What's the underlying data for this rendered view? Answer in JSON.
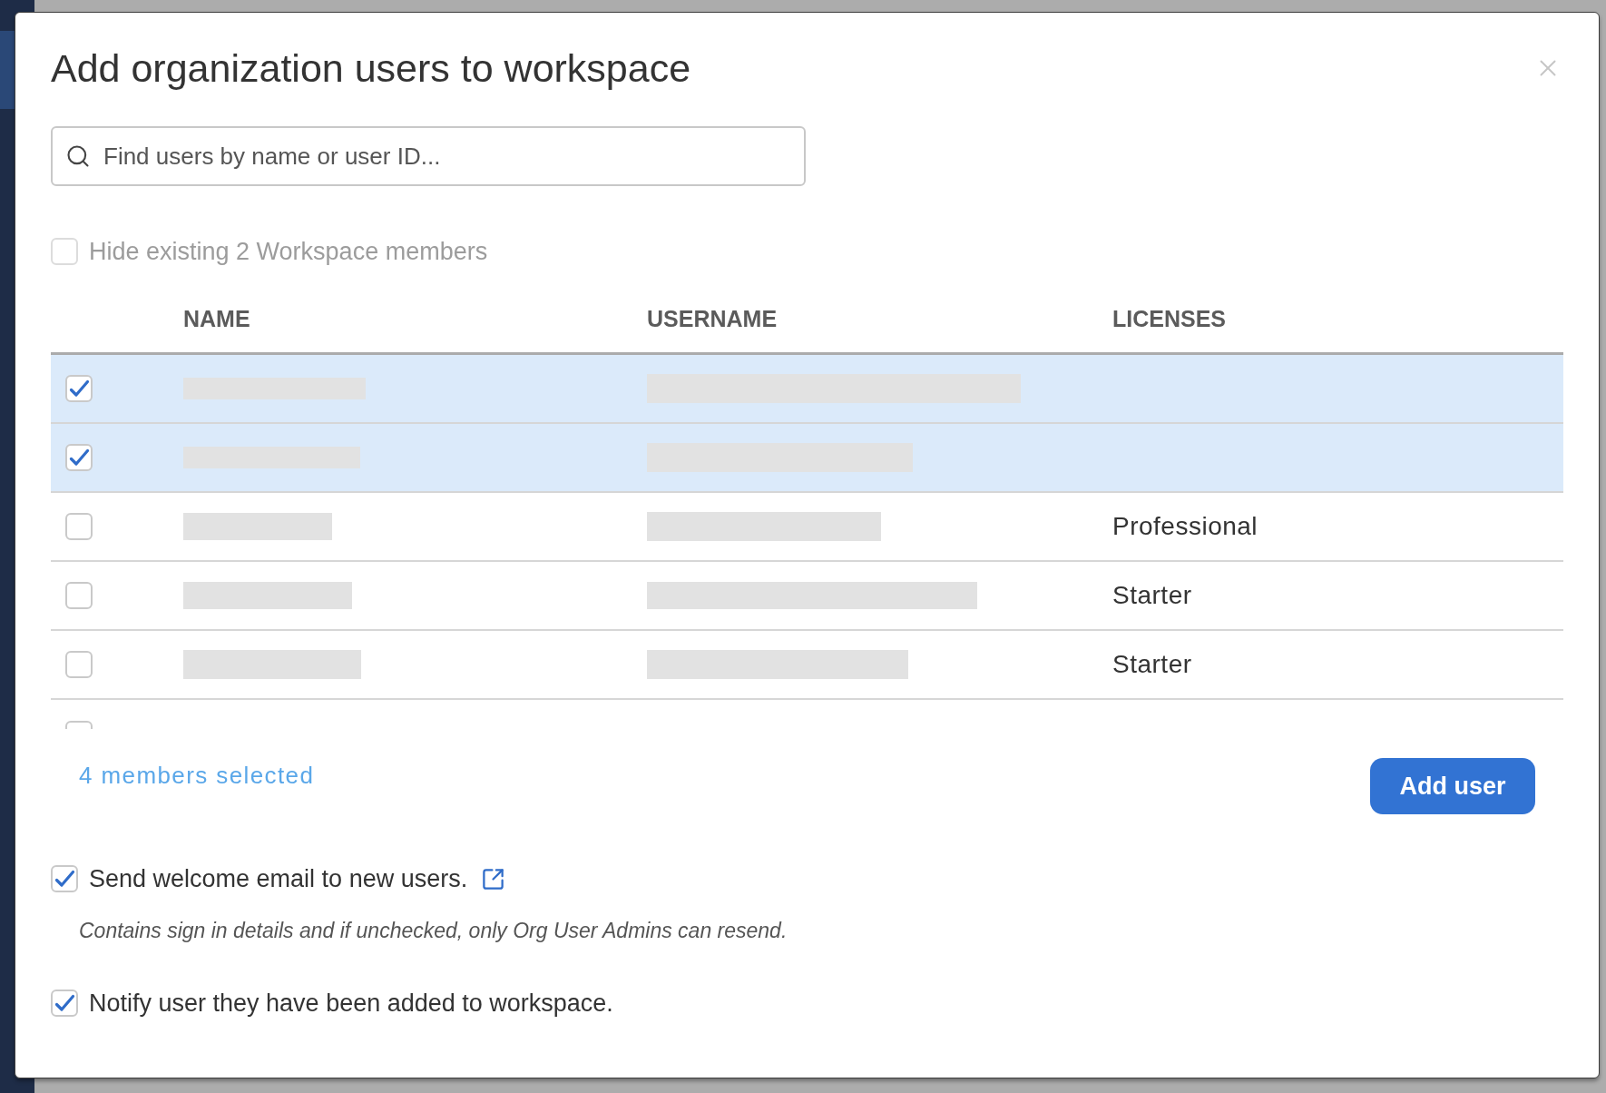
{
  "dialog": {
    "title": "Add organization users to workspace"
  },
  "search": {
    "placeholder": "Find users by name or user ID..."
  },
  "hide_existing": {
    "label": "Hide existing 2 Workspace members",
    "checked": false,
    "disabled": true
  },
  "table": {
    "columns": [
      "NAME",
      "USERNAME",
      "LICENSES"
    ],
    "rows": [
      {
        "checked": true,
        "redacted": true
      },
      {
        "checked": true,
        "redacted": true
      },
      {
        "checked": false,
        "redacted": true,
        "license": "Professional"
      },
      {
        "checked": false,
        "redacted": true,
        "license": "Starter"
      },
      {
        "checked": false,
        "redacted": true,
        "license": "Starter"
      },
      {
        "checked": false
      }
    ]
  },
  "selection_summary": "4 members selected",
  "add_button": "Add user",
  "options": [
    {
      "label": "Send welcome email to new users.",
      "checked": true,
      "external_link": true,
      "hint": "Contains sign in details and if unchecked, only Org User Admins can resend."
    },
    {
      "label": "Notify user they have been added to workspace.",
      "checked": true,
      "external_link": false
    }
  ]
}
